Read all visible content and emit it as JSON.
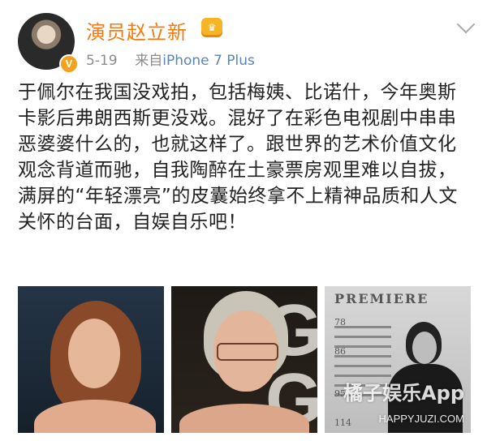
{
  "post": {
    "author": {
      "name": "演员赵立新",
      "verified_badge": "V"
    },
    "meta": {
      "date": "5-19",
      "source_prefix": "来自",
      "source_device": "iPhone 7 Plus"
    },
    "content": "于佩尔在我国没戏拍，包括梅姨、比诺什，今年奥斯卡影后弗朗西斯更没戏。混好了在彩色电视剧中串串恶婆婆什么的，也就这样了。跟世界的艺术价值文化观念背道而驰，自我陶醉在土豪票房观里难以自拔，满屏的“年轻漂亮”的皮囊始终拿不上精神品质和人文关怀的台面，自娱自乐吧！",
    "images": [
      {
        "subject": "red-carpet-actress-red-hair"
      },
      {
        "subject": "actress-with-glasses-gray-hair",
        "background_text": [
          "G",
          "G"
        ]
      },
      {
        "subject": "magazine-cover",
        "magazine_title": "PREMIERE",
        "page_numbers": [
          "78",
          "86",
          "95",
          "114"
        ],
        "watermark": "橘子娱乐App",
        "watermark_url": "HAPPYJUZI.COM"
      }
    ]
  },
  "colors": {
    "author": "#f07b14",
    "source_link": "#5a84b8",
    "meta": "#8c8c8c"
  },
  "icons": {
    "vip": "vip-crown-icon",
    "more": "chevron-down-icon"
  }
}
